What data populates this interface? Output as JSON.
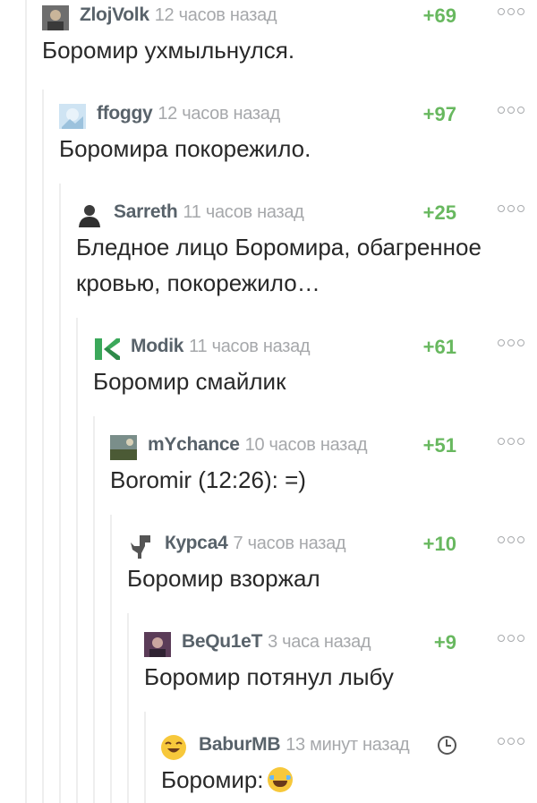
{
  "comments": [
    {
      "user": "ZlojVolk",
      "time": "12 часов назад",
      "rating": "+69",
      "text": "Боромир ухмыльнулся.",
      "avatar_icon": "user-photo-icon",
      "avatar_color": "#5b5b5b"
    },
    {
      "user": "ffoggy",
      "time": "12 часов назад",
      "rating": "+97",
      "text": "Боромира покорежило.",
      "avatar_icon": "landscape-avatar-icon",
      "avatar_color": "#b7d7ee"
    },
    {
      "user": "Sarreth",
      "time": "11 часов назад",
      "rating": "+25",
      "text": "Бледное лицо Боромира, обагренное кровью, покорежило…",
      "avatar_icon": "person-silhouette-icon",
      "avatar_color": "#3c3c3c"
    },
    {
      "user": "Modik",
      "time": "11 часов назад",
      "rating": "+61",
      "text": "Боромир смайлик",
      "avatar_icon": "green-k-logo-icon",
      "avatar_color": "#3ba85a"
    },
    {
      "user": "mYchance",
      "time": "10 часов назад",
      "rating": "+51",
      "text": "Boromir (12:26): =)",
      "avatar_icon": "landscape-photo-icon",
      "avatar_color": "#5f6f4a"
    },
    {
      "user": "Курса4",
      "time": "7 часов назад",
      "rating": "+10",
      "text": "Боромир взоржал",
      "avatar_icon": "dinosaur-icon",
      "avatar_color": "#6b6b6b"
    },
    {
      "user": "BeQu1eT",
      "time": "3 часа назад",
      "rating": "+9",
      "text": "Боромир потянул лыбу",
      "avatar_icon": "character-photo-icon",
      "avatar_color": "#6a4f6a"
    },
    {
      "user": "BaburMB",
      "time": "13 минут назад",
      "rating": "",
      "text": "Боромир:",
      "avatar_icon": "laughing-emoji-icon",
      "avatar_color": "#f7c83b",
      "text_emoji": "tears-of-joy-emoji-icon"
    }
  ],
  "accent_color": "#68b85f"
}
